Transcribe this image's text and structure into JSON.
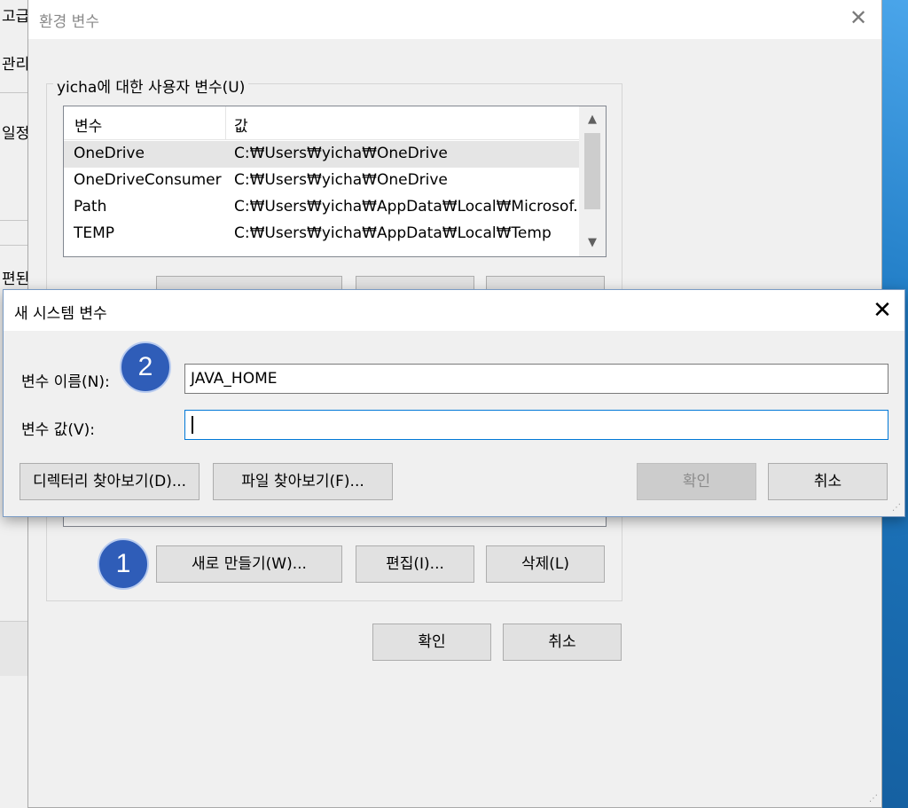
{
  "background_window": {
    "texts": [
      "고급",
      "관리",
      "일정",
      "편된"
    ]
  },
  "env_window": {
    "title": "환경 변수",
    "user_group": {
      "legend": "yicha에 대한 사용자 변수(U)",
      "columns": [
        "변수",
        "값"
      ],
      "rows": [
        {
          "name": "OneDrive",
          "value": "C:₩Users₩yicha₩OneDrive"
        },
        {
          "name": "OneDriveConsumer",
          "value": "C:₩Users₩yicha₩OneDrive"
        },
        {
          "name": "Path",
          "value": "C:₩Users₩yicha₩AppData₩Local₩Microsof..."
        },
        {
          "name": "TEMP",
          "value": "C:₩Users₩yicha₩AppData₩Local₩Temp"
        }
      ]
    },
    "system_buttons": {
      "new": "새로 만들기(W)...",
      "edit": "편집(I)...",
      "delete": "삭제(L)"
    },
    "footer_buttons": {
      "ok": "확인",
      "cancel": "취소"
    }
  },
  "dialog": {
    "title": "새 시스템 변수",
    "name_label": "변수 이름(N):",
    "name_value": "JAVA_HOME",
    "value_label": "변수 값(V):",
    "value_value": "",
    "browse_dir": "디렉터리 찾아보기(D)...",
    "browse_file": "파일 찾아보기(F)...",
    "ok": "확인",
    "cancel": "취소"
  },
  "annotations": {
    "step1": "1",
    "step2": "2"
  },
  "colors": {
    "badge": "#2f5db8",
    "focus_border": "#0078d7",
    "desktop": "#1f7bc4"
  }
}
